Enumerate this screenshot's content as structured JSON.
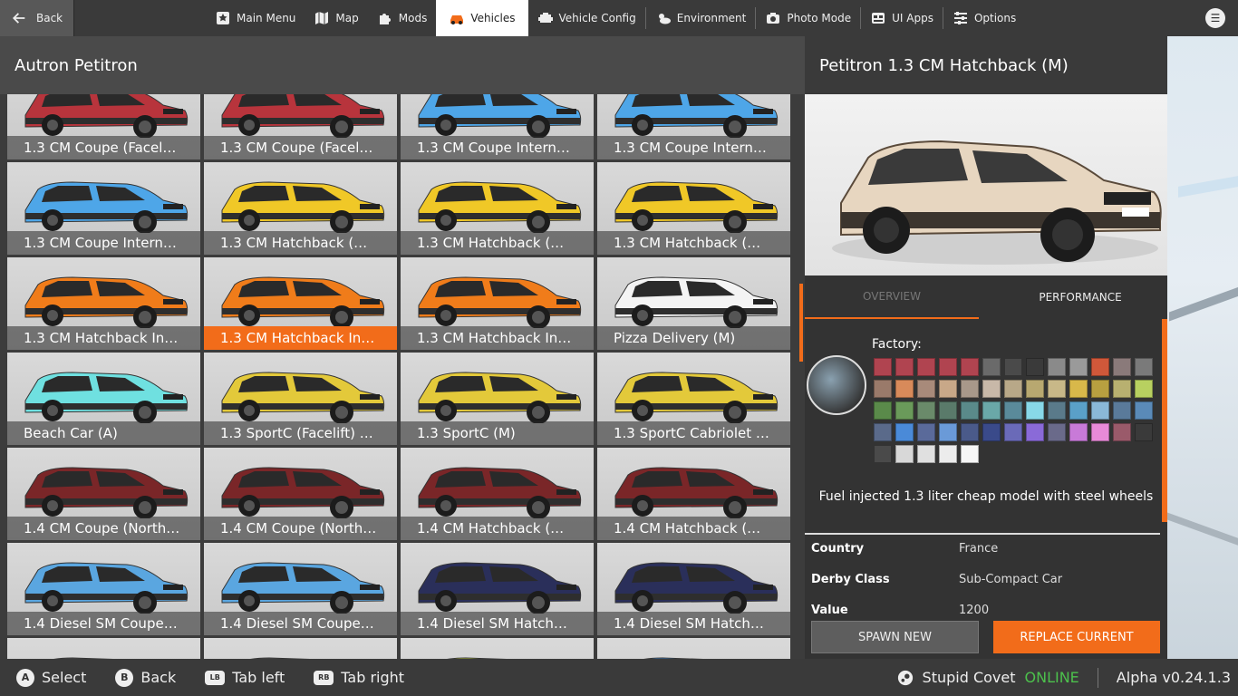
{
  "nav": {
    "back_label": "Back",
    "items": [
      {
        "label": "Main Menu",
        "icon": "main-menu-icon"
      },
      {
        "label": "Map",
        "icon": "map-icon"
      },
      {
        "label": "Mods",
        "icon": "puzzle-icon"
      },
      {
        "label": "Vehicles",
        "icon": "car-icon",
        "active": true
      },
      {
        "label": "Vehicle Config",
        "icon": "engine-icon"
      },
      {
        "label": "Environment",
        "icon": "weather-icon"
      },
      {
        "label": "Photo Mode",
        "icon": "camera-icon"
      },
      {
        "label": "UI Apps",
        "icon": "ui-apps-icon"
      },
      {
        "label": "Options",
        "icon": "sliders-icon"
      }
    ]
  },
  "left": {
    "title": "Autron Petitron",
    "tiles": [
      {
        "label": "1.3 CM Coupe (Facel…",
        "color": "#b8343c"
      },
      {
        "label": "1.3 CM Coupe (Facel…",
        "color": "#b8343c"
      },
      {
        "label": "1.3 CM Coupe Intern…",
        "color": "#4ea6e8"
      },
      {
        "label": "1.3 CM Coupe Intern…",
        "color": "#4ea6e8"
      },
      {
        "label": "1.3 CM Coupe Intern…",
        "color": "#4ea6e8"
      },
      {
        "label": "1.3 CM Hatchback (…",
        "color": "#f0c827"
      },
      {
        "label": "1.3 CM Hatchback (…",
        "color": "#f0c827"
      },
      {
        "label": "1.3 CM Hatchback (…",
        "color": "#f0c827"
      },
      {
        "label": "1.3 CM Hatchback In…",
        "color": "#f07c1a"
      },
      {
        "label": "1.3 CM Hatchback In…",
        "color": "#f07c1a",
        "selected": true
      },
      {
        "label": "1.3 CM Hatchback In…",
        "color": "#f07c1a"
      },
      {
        "label": "Pizza Delivery (M)",
        "color": "#f4f4f4"
      },
      {
        "label": "Beach Car (A)",
        "color": "#6fe0e0"
      },
      {
        "label": "1.3 SportC (Facelift) …",
        "color": "#e3c93a"
      },
      {
        "label": "1.3 SportC (M)",
        "color": "#e3c93a"
      },
      {
        "label": "1.3 SportC Cabriolet …",
        "color": "#e3c93a"
      },
      {
        "label": "1.4 CM Coupe (North…",
        "color": "#7a2628"
      },
      {
        "label": "1.4 CM Coupe (North…",
        "color": "#7a2628"
      },
      {
        "label": "1.4 CM Hatchback (…",
        "color": "#7a2628"
      },
      {
        "label": "1.4 CM Hatchback (…",
        "color": "#7a2628"
      },
      {
        "label": "1.4 Diesel SM Coupe…",
        "color": "#5aa6e0"
      },
      {
        "label": "1.4 Diesel SM Coupe…",
        "color": "#5aa6e0"
      },
      {
        "label": "1.4 Diesel SM Hatch…",
        "color": "#2a2f5a"
      },
      {
        "label": "1.4 Diesel SM Hatch…",
        "color": "#2a2f5a"
      },
      {
        "label": "",
        "color": "#555555"
      },
      {
        "label": "",
        "color": "#555555"
      },
      {
        "label": "",
        "color": "#d8e83a"
      },
      {
        "label": "",
        "color": "#3a8ee0"
      }
    ]
  },
  "right": {
    "title": "Petitron 1.3 CM Hatchback (M)",
    "tabs": [
      "OVERVIEW",
      "PERFORMANCE"
    ],
    "factory_label": "Factory:",
    "swatches": [
      "#b04450",
      "#b04450",
      "#b04450",
      "#b04450",
      "#b04450",
      "#6a6a6a",
      "#4a4a4a",
      "#3a3a3a",
      "#8a8a8a",
      "#9a9a9a",
      "#d0583a",
      "#8a7a7a",
      "#7a7a7a",
      "#9a7a6a",
      "#d88a5a",
      "#a88a7a",
      "#c8a888",
      "#a8988a",
      "#c8b8a8",
      "#b8a888",
      "#b8a870",
      "#c8b888",
      "#d8b84a",
      "#b8a040",
      "#b8b070",
      "#b8d060",
      "#5a8a4a",
      "#6a9a5a",
      "#6a8a6a",
      "#5a7a6a",
      "#5a8a8a",
      "#6aa8a8",
      "#5a8a9a",
      "#88d8e8",
      "#5a7a8a",
      "#5aa0c8",
      "#8ab8d8",
      "#5a7a9a",
      "#5a8ab8",
      "#5a6a8a",
      "#4a8ad8",
      "#5a6a9a",
      "#6a9ad8",
      "#4a5a8a",
      "#3a4a8a",
      "#6a6ab8",
      "#8a6ad8",
      "#6a6a8a",
      "#c87ad8",
      "#e88ad8",
      "#9a5a6a",
      "#3a3a3a",
      "#4a4a4a",
      "#d8d8d8",
      "#e0e0e0",
      "#ececec",
      "#f6f6f6"
    ],
    "description": "Fuel injected 1.3 liter cheap model with steel wheels",
    "info": [
      {
        "key": "Country",
        "value": "France"
      },
      {
        "key": "Derby Class",
        "value": "Sub-Compact Car"
      },
      {
        "key": "Value",
        "value": "1200"
      }
    ],
    "spawn_label": "SPAWN NEW",
    "replace_label": "REPLACE CURRENT",
    "preview_color": "#e7d6c0"
  },
  "bottom": {
    "actions": [
      {
        "btn": "A",
        "label": "Select"
      },
      {
        "btn": "B",
        "label": "Back"
      },
      {
        "btn": "LB",
        "label": "Tab left"
      },
      {
        "btn": "RB",
        "label": "Tab right"
      }
    ],
    "user": "Stupid Covet",
    "status": "ONLINE",
    "version": "Alpha v0.24.1.3"
  },
  "accent": "#f26c1a"
}
